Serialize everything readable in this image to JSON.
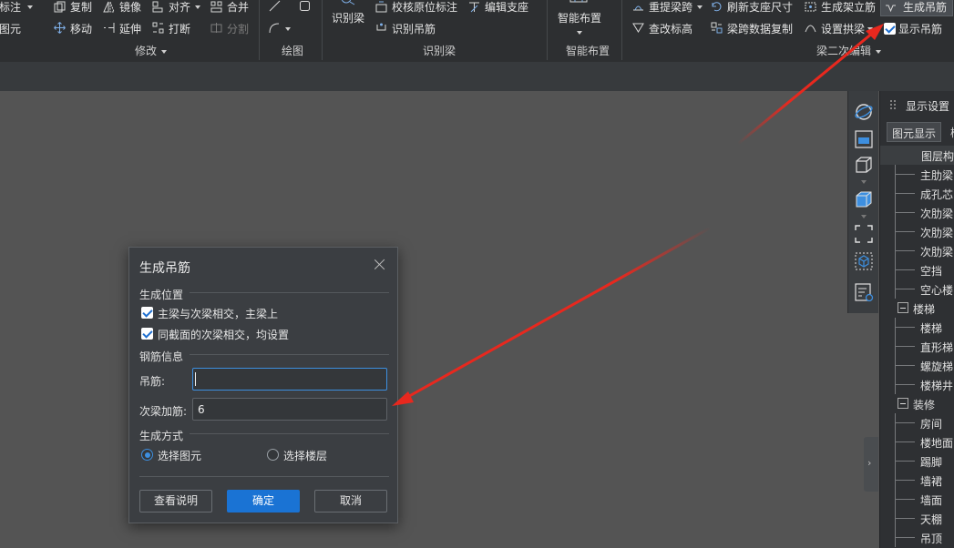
{
  "ribbon": {
    "modify": {
      "label_annotate": "标注",
      "label_element": "图元",
      "copy": "复制",
      "mirror": "镜像",
      "align": "对齐",
      "merge": "合并",
      "move": "移动",
      "extend": "延伸",
      "break": "打断",
      "split": "分割",
      "group_label": "修改"
    },
    "draw": {
      "group_label": "绘图"
    },
    "identify": {
      "identify_beam": "识别梁",
      "check_original_label": "校核原位标注",
      "edit_support": "编辑支座",
      "identify_hanger": "识别吊筋",
      "group_label": "识别梁"
    },
    "smart": {
      "smart_layout": "智能布置",
      "group_label": "智能布置"
    },
    "beam_edit": {
      "re_extract_span": "重提梁跨",
      "refresh_support_size": "刷新支座尺寸",
      "gen_frame_stirrup": "生成架立筋",
      "gen_hanger": "生成吊筋",
      "check_elevation": "查改标高",
      "copy_span_data": "梁跨数据复制",
      "set_arch_beam": "设置拱梁",
      "show_hanger": "显示吊筋",
      "group_label": "梁二次编辑"
    }
  },
  "side_panel": {
    "title": "显示设置",
    "tabs": [
      "图元显示",
      "楼"
    ],
    "column_header": "图层构",
    "tree": [
      {
        "label": "主肋梁",
        "level": 2
      },
      {
        "label": "成孔芯",
        "level": 2
      },
      {
        "label": "次肋梁",
        "level": 2
      },
      {
        "label": "次肋梁",
        "level": 2
      },
      {
        "label": "次肋梁",
        "level": 2
      },
      {
        "label": "空挡",
        "level": 2
      },
      {
        "label": "空心楼",
        "level": 2
      },
      {
        "label": "楼梯",
        "level": 1
      },
      {
        "label": "楼梯",
        "level": 2
      },
      {
        "label": "直形梯",
        "level": 2
      },
      {
        "label": "螺旋梯",
        "level": 2
      },
      {
        "label": "楼梯井",
        "level": 2
      },
      {
        "label": "装修",
        "level": 1
      },
      {
        "label": "房间",
        "level": 2
      },
      {
        "label": "楼地面",
        "level": 2
      },
      {
        "label": "踢脚",
        "level": 2
      },
      {
        "label": "墙裙",
        "level": 2
      },
      {
        "label": "墙面",
        "level": 2
      },
      {
        "label": "天棚",
        "level": 2
      },
      {
        "label": "吊顶",
        "level": 2
      }
    ]
  },
  "dialog": {
    "title": "生成吊筋",
    "position_section": "生成位置",
    "opt_main_secondary": "主梁与次梁相交，主梁上",
    "opt_same_section": "同截面的次梁相交，均设置",
    "rebar_section": "钢筋信息",
    "hanger_label": "吊筋:",
    "hanger_value": "",
    "secondary_label": "次梁加筋:",
    "secondary_value": "6",
    "method_section": "生成方式",
    "method_select_element": "选择图元",
    "method_select_floor": "选择楼层",
    "btn_help": "查看说明",
    "btn_ok": "确定",
    "btn_cancel": "取消"
  },
  "colors": {
    "accent": "#1a73d4",
    "arrow": "#e8281e",
    "canvas": "#545454"
  }
}
